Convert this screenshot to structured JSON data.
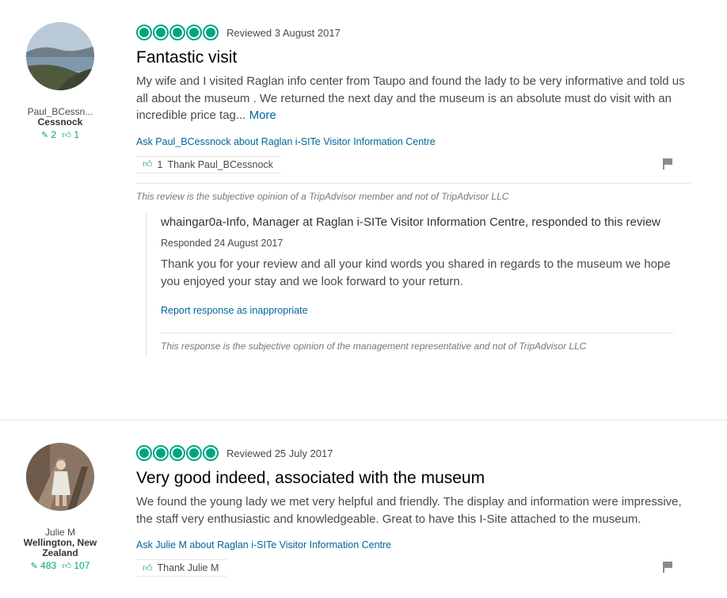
{
  "reviews": [
    {
      "member": {
        "name": "Paul_BCessn...",
        "location": "Cessnock",
        "review_count": "2",
        "helpful_count": "1"
      },
      "rating": 5,
      "date": "Reviewed 3 August 2017",
      "title": "Fantastic visit",
      "text": "My wife and I visited Raglan info center from Taupo and found the lady to be very informative and told us all about the museum . We returned the next day and the museum is an absolute must do visit with an incredible price tag...",
      "more_label": "More",
      "ask_link": "Ask Paul_BCessnock about Raglan i-SITe Visitor Information Centre",
      "thank_count": "1",
      "thank_label": "Thank Paul_BCessnock",
      "disclaimer": "This review is the subjective opinion of a TripAdvisor member and not of TripAdvisor LLC",
      "response": {
        "header": "whaingar0a-Info, Manager at Raglan i-SITe Visitor Information Centre, responded to this review",
        "date": "Responded 24 August 2017",
        "text": "Thank you for your review and all your kind words you shared in regards to the museum we hope you enjoyed your stay and we look forward to your return.",
        "report_label": "Report response as inappropriate",
        "disclaimer": "This response is the subjective opinion of the management representative and not of TripAdvisor LLC"
      }
    },
    {
      "member": {
        "name": "Julie M",
        "location": "Wellington, New Zealand",
        "review_count": "483",
        "helpful_count": "107"
      },
      "rating": 5,
      "date": "Reviewed 25 July 2017",
      "title": "Very good indeed, associated with the museum",
      "text": "We found the young lady we met very helpful and friendly. The display and information were impressive, the staff very enthusiastic and knowledgeable. Great to have this I-Site attached to the museum.",
      "ask_link": "Ask Julie M about Raglan i-SITe Visitor Information Centre",
      "thank_label": "Thank Julie M"
    }
  ],
  "colors": {
    "accent": "#00a680",
    "link": "#006699",
    "text": "#4a4a4a"
  },
  "icons": {
    "review_count": "pencil-review-icon",
    "helpful": "thumbs-up-icon",
    "flag": "flag-icon",
    "rating": "rating-bubble-icon"
  }
}
